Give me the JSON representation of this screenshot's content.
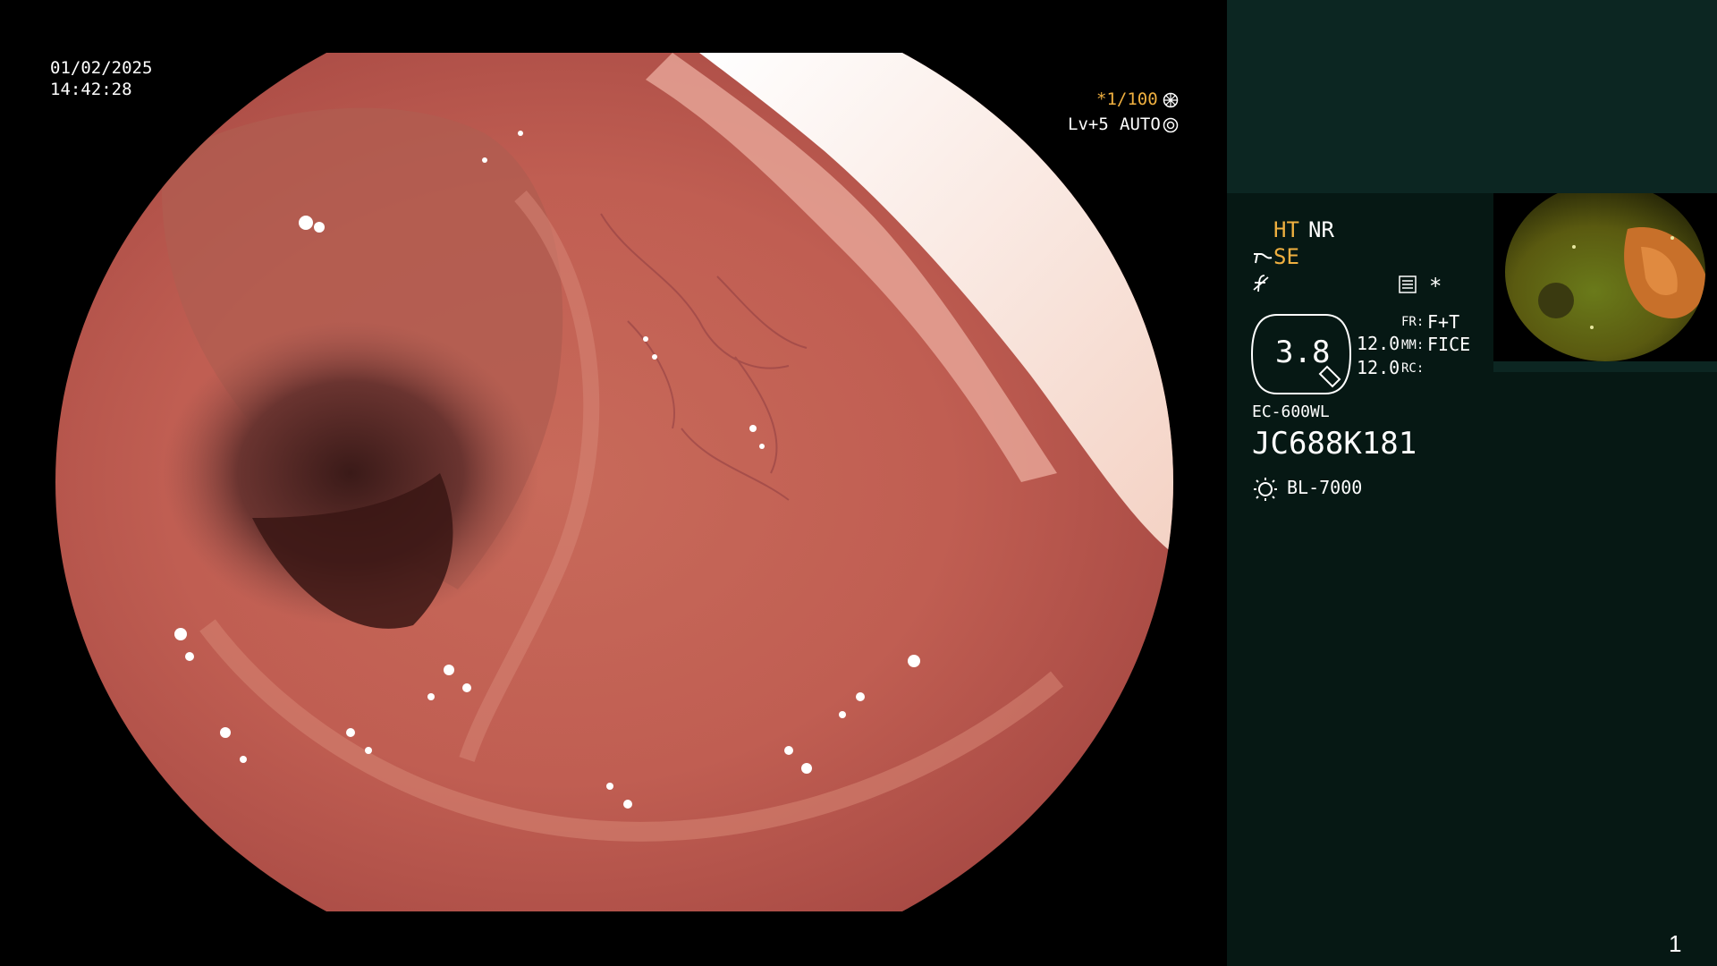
{
  "overlay": {
    "date": "01/02/2025",
    "time": "14:42:28",
    "shutter": "*1/100",
    "shutter_icon": "aperture-icon",
    "level": "Lv+5",
    "exposure_mode": "AUTO",
    "exposure_icon": "iris-icon"
  },
  "panel": {
    "ht_label": "HT",
    "nr_label": "NR",
    "se_label": "SE",
    "se_icon": "structure-enhancement-icon",
    "f_icon": "f-stroke-icon",
    "menu_icon": "menu-list-icon",
    "star": "*",
    "zoom_value": "3.8",
    "value_top": "12.0",
    "value_bottom": "12.0",
    "fr_label": "FR:",
    "fr_value": "F+T",
    "mm_label": "MM:",
    "mm_value": "FICE",
    "rc_label": "RC:",
    "scope_model": "EC-600WL",
    "scope_serial": "JC688K181",
    "light_icon": "light-source-icon",
    "light_source": "BL-7000",
    "page_number": "1"
  },
  "colors": {
    "panel_bg": "#061814",
    "panel_header_bg": "#0c2622",
    "amber": "#f0b040"
  }
}
